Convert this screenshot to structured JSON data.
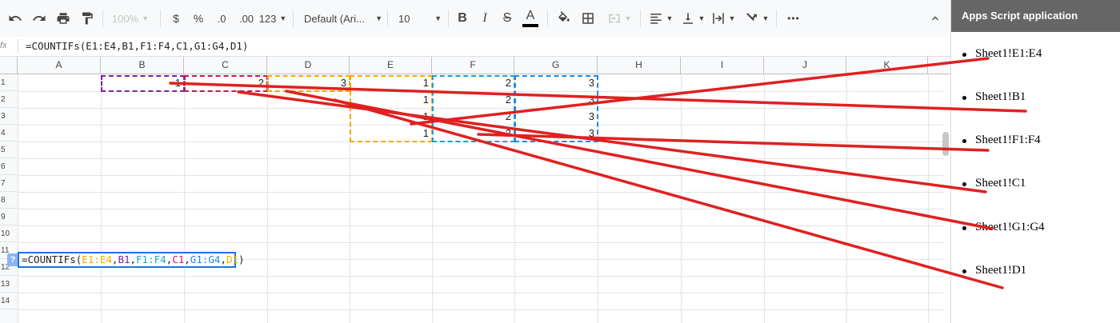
{
  "toolbar": {
    "zoom": "100%",
    "currency": "$",
    "percent": "%",
    "decrease_decimal": ".0",
    "increase_decimal": ".00",
    "number_format": "123",
    "font_name": "Default (Ari...",
    "font_size": "10",
    "bold": "B",
    "italic": "I",
    "strike": "S",
    "text_color": "A",
    "more": "•••"
  },
  "formula_bar": {
    "fx_label": "fx",
    "formula": "=COUNTIFs(E1:E4,B1,F1:F4,C1,G1:G4,D1)"
  },
  "grid": {
    "columns": [
      "A",
      "B",
      "C",
      "D",
      "E",
      "F",
      "G",
      "H",
      "I",
      "J",
      "K"
    ],
    "rows": [
      "1",
      "2",
      "3",
      "4",
      "5",
      "6",
      "7",
      "8",
      "9",
      "10",
      "11",
      "12",
      "13",
      "14"
    ],
    "cells": {
      "B1": "1",
      "C1": "2",
      "D1": "3",
      "E1": "1",
      "F1": "2",
      "G1": "3",
      "E2": "1",
      "F2": "2",
      "G2": "3",
      "E3": "1",
      "F3": "2",
      "G3": "3",
      "E4": "1",
      "F4": "2",
      "G4": "3"
    },
    "editor": {
      "help": "?",
      "prefix": "=COUNTIFs(",
      "a1": "E1:E4",
      "c1": ",",
      "a2": "B1",
      "c2": ",",
      "a3": "F1:F4",
      "c3": ",",
      "a4": "C1",
      "c4": ",",
      "a5": "G1:G4",
      "c5": ",",
      "a6": "D1",
      "suffix": ")"
    },
    "range_colors": {
      "E1:E4": "#f4a900",
      "B1": "#7b1fa2",
      "F1:F4": "#1aa3c7",
      "C1": "#c2185b",
      "G1:G4": "#1e88e5",
      "D1": "#f4a900"
    }
  },
  "sidebar": {
    "title": "Apps Script application",
    "items": [
      "Sheet1!E1:E4",
      "Sheet1!B1",
      "Sheet1!F1:F4",
      "Sheet1!C1",
      "Sheet1!G1:G4",
      "Sheet1!D1"
    ]
  },
  "annotation": {
    "line_color": "#e02020"
  }
}
